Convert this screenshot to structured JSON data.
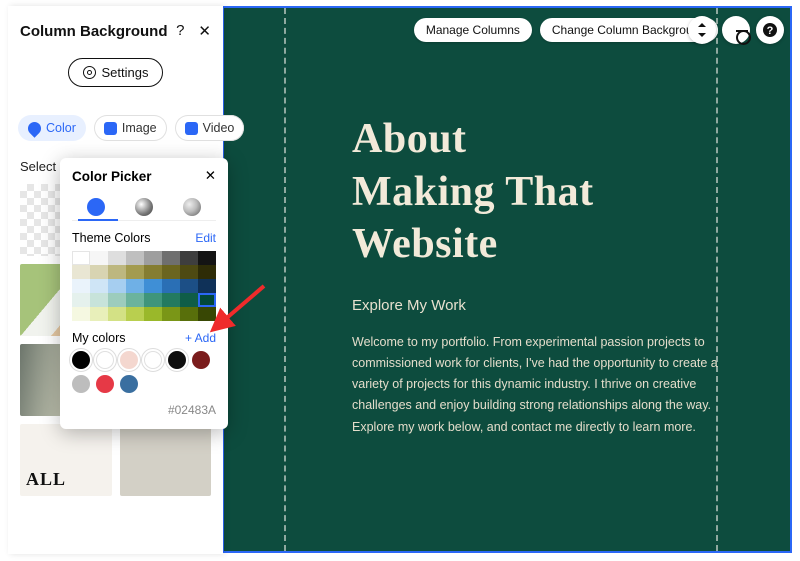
{
  "panel": {
    "title": "Column Background",
    "help": "?",
    "close": "✕",
    "settings_label": "Settings",
    "tabs": {
      "color": "Color",
      "image": "Image",
      "video": "Video"
    },
    "select_label": "Select",
    "thumb_all": "ALL"
  },
  "picker": {
    "title": "Color Picker",
    "close": "✕",
    "theme_label": "Theme Colors",
    "edit": "Edit",
    "mycolors_label": "My colors",
    "add": "+ Add",
    "hex": "#02483A",
    "theme_rows": [
      [
        "#ffffff",
        "#f6f6f6",
        "#dedede",
        "#bfbfbf",
        "#9e9e9e",
        "#6f6f6f",
        "#3e3e3e",
        "#141414"
      ],
      [
        "#e9e6d3",
        "#d8d4b2",
        "#bdb77f",
        "#a39b4f",
        "#857d31",
        "#6b651f",
        "#4e4a12",
        "#2e2c07"
      ],
      [
        "#eaf3fb",
        "#cfe5f6",
        "#a6cef0",
        "#6fb0e6",
        "#3f8fd6",
        "#2a6fb5",
        "#1c4f86",
        "#0f3158"
      ],
      [
        "#e5f1ed",
        "#c7e3da",
        "#9cccbd",
        "#6bb39d",
        "#3f957b",
        "#237a60",
        "#0f5d48",
        "#02483A"
      ],
      [
        "#f5f8e1",
        "#e8efba",
        "#d3e185",
        "#b9cf4f",
        "#9ab82a",
        "#7a9617",
        "#586f0b",
        "#384704"
      ]
    ],
    "theme_selected": {
      "row": 3,
      "col": 7
    },
    "my_colors": [
      "#000000",
      "#ffffff",
      "#f4d7cf",
      "#ffffff",
      "#0d0d0d",
      "#7a1c1c",
      "#bdbdbd",
      "#e63946",
      "#3a6fa0"
    ]
  },
  "top_actions": {
    "manage": "Manage Columns",
    "change_bg": "Change Column Background"
  },
  "hero": {
    "h1a": "About",
    "h1b": "Making That",
    "h1c": "Website",
    "sub": "Explore My Work",
    "body": "Welcome to my portfolio. From experimental passion projects to commissioned work for clients, I've had the opportunity to create a variety of projects for this dynamic industry. I thrive on creative challenges and enjoy building strong relationships along the way. Explore my work below, and contact me directly to learn more."
  }
}
